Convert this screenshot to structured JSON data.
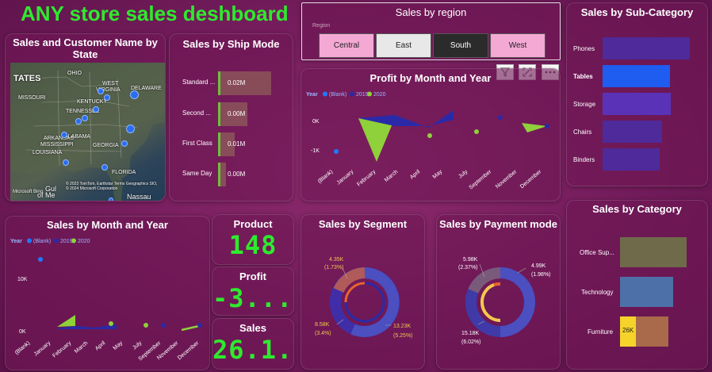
{
  "dashboard_title": "ANY store sales deshboard",
  "map_card": {
    "title": "Sales and Customer Name by State",
    "labels": [
      "TATES",
      "OHIO",
      "WEST",
      "VIRGINIA",
      "MISSOURI",
      "KENTUCKY",
      "DELAWARE",
      "TENNESSEE",
      "ARKANSAS",
      "ALABAMA",
      "MISSISSIPPI",
      "GEORGIA",
      "LOUISIANA",
      "FLORIDA",
      "Gul",
      "of Me",
      "Nassau"
    ],
    "attribution": "© 2023 TomTom, Earthstar Terms Geographics SIO, © 2024 Microsoft Corporation",
    "logo": "Microsoft Bing"
  },
  "ship_mode": {
    "title": "Sales by Ship Mode",
    "rows": [
      {
        "label": "Standard ...",
        "value": "0.02M",
        "frac": 1.0
      },
      {
        "label": "Second ...",
        "value": "0.00M",
        "frac": 0.55
      },
      {
        "label": "First Class",
        "value": "0.01M",
        "frac": 0.32
      },
      {
        "label": "Same Day",
        "value": "0.00M",
        "frac": 0.15
      }
    ]
  },
  "region_slicer": {
    "title": "Sales by region",
    "field_label": "Region",
    "options": [
      "Central",
      "East",
      "South",
      "West"
    ],
    "selected": "South"
  },
  "subcategory": {
    "title": "Sales by Sub-Category",
    "rows": [
      {
        "label": "Phones",
        "frac": 1.0,
        "color": "#4e2a9a"
      },
      {
        "label": "Tables",
        "frac": 0.77,
        "color": "#1f5cf0"
      },
      {
        "label": "Storage",
        "frac": 0.78,
        "color": "#5a32b8"
      },
      {
        "label": "Chairs",
        "frac": 0.68,
        "color": "#4e2a9a"
      },
      {
        "label": "Binders",
        "frac": 0.65,
        "color": "#4e2a9a"
      }
    ]
  },
  "profit_chart": {
    "title": "Profit by Month and Year",
    "legend_title": "Year",
    "legend": [
      {
        "name": "(Blank)",
        "color": "#1f7aff"
      },
      {
        "name": "2019",
        "color": "#2a2aa8"
      },
      {
        "name": "2020",
        "color": "#8fd13a"
      }
    ],
    "y_ticks": [
      "0K",
      "-1K"
    ],
    "x_labels": [
      "(Blank)",
      "January",
      "February",
      "March",
      "April",
      "May",
      "July",
      "September",
      "November",
      "December"
    ]
  },
  "sales_month_chart": {
    "title": "Sales by Month and Year",
    "legend_title": "Year",
    "legend": [
      {
        "name": "(Blank)",
        "color": "#1f7aff"
      },
      {
        "name": "2019",
        "color": "#2a2aa8"
      },
      {
        "name": "2020",
        "color": "#8fd13a"
      }
    ],
    "y_ticks": [
      "10K",
      "0K"
    ],
    "x_labels": [
      "(Blank)",
      "January",
      "February",
      "March",
      "April",
      "May",
      "July",
      "September",
      "November",
      "December"
    ]
  },
  "kpis": {
    "product_label": "Product",
    "product_value": "148",
    "profit_label": "Profit",
    "profit_value": "-3....",
    "sales_label": "Sales",
    "sales_value": "26.1..."
  },
  "segment": {
    "title": "Sales by Segment",
    "labels": [
      {
        "value": "4.35K",
        "pct": "(1.73%)"
      },
      {
        "value": "8.58K",
        "pct": "(3.4%)"
      },
      {
        "value": "13.23K",
        "pct": "(5.25%)"
      }
    ]
  },
  "payment": {
    "title": "Sales by Payment mode",
    "labels": [
      {
        "value": "5.98K",
        "pct": "(2.37%)"
      },
      {
        "value": "4.99K",
        "pct": "(1.98%)"
      },
      {
        "value": "15.18K",
        "pct": "(6.02%)"
      }
    ]
  },
  "category": {
    "title": "Sales by Category",
    "rows": [
      {
        "label": "Office Sup...",
        "frac": 1.0,
        "color": "#6f6a4a"
      },
      {
        "label": "Technology",
        "frac": 0.8,
        "color": "#4d70a8"
      },
      {
        "label": "Furniture",
        "frac": 0.73,
        "color": "#a86a4a",
        "value": "26K"
      }
    ]
  },
  "colors": {
    "accent": "#2eea2e",
    "background": "#7a1f62"
  }
}
